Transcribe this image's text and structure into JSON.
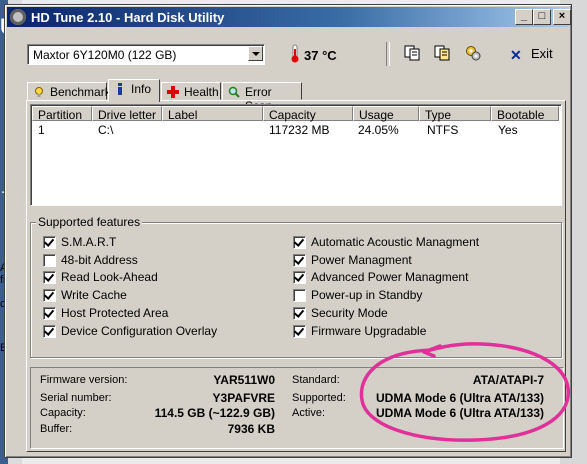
{
  "window": {
    "title": "HD Tune 2.10 - Hard Disk Utility",
    "controls": [
      "_",
      "□",
      "×"
    ]
  },
  "toolbar": {
    "drive": "Maxtor 6Y120M0 (122 GB)",
    "temperature": "37 °C",
    "exit_label": "Exit",
    "icons": [
      "copy-icon",
      "copy-all-icon",
      "options-icon"
    ]
  },
  "tabs": [
    {
      "label": "Benchmark",
      "icon": "benchmark-icon"
    },
    {
      "label": "Info",
      "icon": "info-icon",
      "active": true
    },
    {
      "label": "Health",
      "icon": "health-icon"
    },
    {
      "label": "Error Scan",
      "icon": "error-scan-icon"
    }
  ],
  "partitions": {
    "columns": [
      "Partition",
      "Drive letter",
      "Label",
      "Capacity",
      "Usage",
      "Type",
      "Bootable"
    ],
    "rows": [
      [
        "1",
        "C:\\",
        "",
        "117232 MB",
        "24.05%",
        "NTFS",
        "Yes"
      ]
    ]
  },
  "features": {
    "title": "Supported features",
    "left": [
      {
        "label": "S.M.A.R.T",
        "checked": true
      },
      {
        "label": "48-bit Address",
        "checked": false
      },
      {
        "label": "Read Look-Ahead",
        "checked": true
      },
      {
        "label": "Write Cache",
        "checked": true
      },
      {
        "label": "Host Protected Area",
        "checked": true
      },
      {
        "label": "Device Configuration Overlay",
        "checked": true
      }
    ],
    "right": [
      {
        "label": "Automatic Acoustic Managment",
        "checked": true
      },
      {
        "label": "Power Managment",
        "checked": true
      },
      {
        "label": "Advanced Power Managment",
        "checked": true
      },
      {
        "label": "Power-up in Standby",
        "checked": false
      },
      {
        "label": "Security Mode",
        "checked": true
      },
      {
        "label": "Firmware Upgradable",
        "checked": true
      }
    ]
  },
  "details": {
    "firmware_label": "Firmware version:",
    "firmware": "YAR511W0",
    "serial_label": "Serial number:",
    "serial": "Y3PAFVRE",
    "capacity_label": "Capacity:",
    "capacity": "114.5 GB (~122.9 GB)",
    "buffer_label": "Buffer:",
    "buffer": "7936 KB",
    "standard_label": "Standard:",
    "standard": "ATA/ATAPI-7",
    "supported_label": "Supported:",
    "supported": "UDMA Mode 6 (Ultra ATA/133)",
    "active_label": "Active:",
    "active": "UDMA Mode 6 (Ultra ATA/133)"
  },
  "background_fragments": [
    "U",
    "T",
    "A",
    "fic",
    "ch",
    "Eir"
  ],
  "colors": {
    "titlebar": "#0a246a",
    "face": "#d4d0c8",
    "annotation": "#e0309a"
  }
}
